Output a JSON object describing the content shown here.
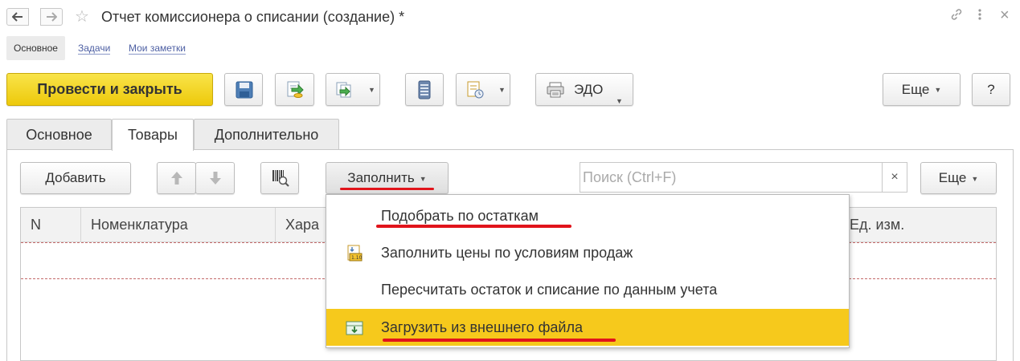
{
  "window": {
    "title": "Отчет комиссионера о списании (создание) *",
    "back_glyph": "🡐",
    "forward_glyph": "→",
    "star_glyph": "☆",
    "link_icon": "link-icon",
    "menu_icon": "more-vertical-icon",
    "close_glyph": "×"
  },
  "section_tabs": [
    {
      "label": "Основное",
      "active": true
    },
    {
      "label": "Задачи",
      "active": false
    },
    {
      "label": "Мои заметки",
      "active": false
    }
  ],
  "toolbar": {
    "post_close_label": "Провести и закрыть",
    "edo_label": "ЭДО",
    "more_label": "Еще",
    "help_label": "?",
    "primary_color": "#f2d31b"
  },
  "form_tabs": [
    {
      "label": "Основное",
      "active": false
    },
    {
      "label": "Товары",
      "active": true
    },
    {
      "label": "Дополнительно",
      "active": false
    }
  ],
  "goods_toolbar": {
    "add_label": "Добавить",
    "fill_label": "Заполнить",
    "search_placeholder": "Поиск (Ctrl+F)",
    "search_clear": "×",
    "more_label": "Еще"
  },
  "table": {
    "columns": [
      "N",
      "Номенклатура",
      "Хара",
      "Ед. изм."
    ]
  },
  "fill_menu": {
    "items": [
      {
        "label": "Подобрать по остаткам",
        "icon": "",
        "highlighted": false,
        "underlined": true
      },
      {
        "label": "Заполнить цены по условиям продаж",
        "icon": "price-fill-icon",
        "highlighted": false,
        "underlined": false
      },
      {
        "label": "Пересчитать остаток и списание по данным учета",
        "icon": "",
        "highlighted": false,
        "underlined": false
      },
      {
        "label": "Загрузить из внешнего файла",
        "icon": "import-file-icon",
        "highlighted": true,
        "underlined": true
      }
    ],
    "highlight_color": "#f6c91c",
    "annotation_color": "#e1141b"
  }
}
